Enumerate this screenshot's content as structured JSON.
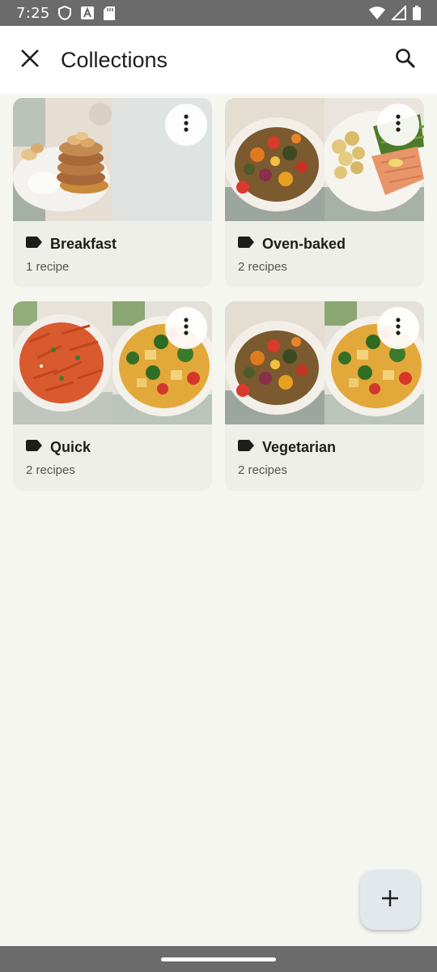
{
  "status_bar": {
    "time": "7:25",
    "left_icons": [
      "shield-icon",
      "text-a-icon",
      "sd-card-icon"
    ],
    "right_icons": [
      "wifi-icon",
      "signal-icon",
      "battery-icon"
    ]
  },
  "app_bar": {
    "title": "Collections",
    "close_icon": "close-icon",
    "search_icon": "search-icon"
  },
  "collections": [
    {
      "name": "Breakfast",
      "count": "1 recipe",
      "images": [
        "pancakes",
        "placeholder"
      ]
    },
    {
      "name": "Oven-baked",
      "count": "2 recipes",
      "images": [
        "roasted-vegetables",
        "salmon-potatoes"
      ]
    },
    {
      "name": "Quick",
      "count": "2 recipes",
      "images": [
        "pasta",
        "vegetable-curry"
      ]
    },
    {
      "name": "Vegetarian",
      "count": "2 recipes",
      "images": [
        "roasted-vegetables",
        "vegetable-curry"
      ]
    }
  ],
  "fab": {
    "icon": "plus-icon"
  },
  "colors": {
    "background": "#f6f6f1",
    "card": "#efefe9",
    "app_bar": "#ffffff",
    "fab": "#e3e8ec",
    "system_bars": "#6b6b6b"
  }
}
